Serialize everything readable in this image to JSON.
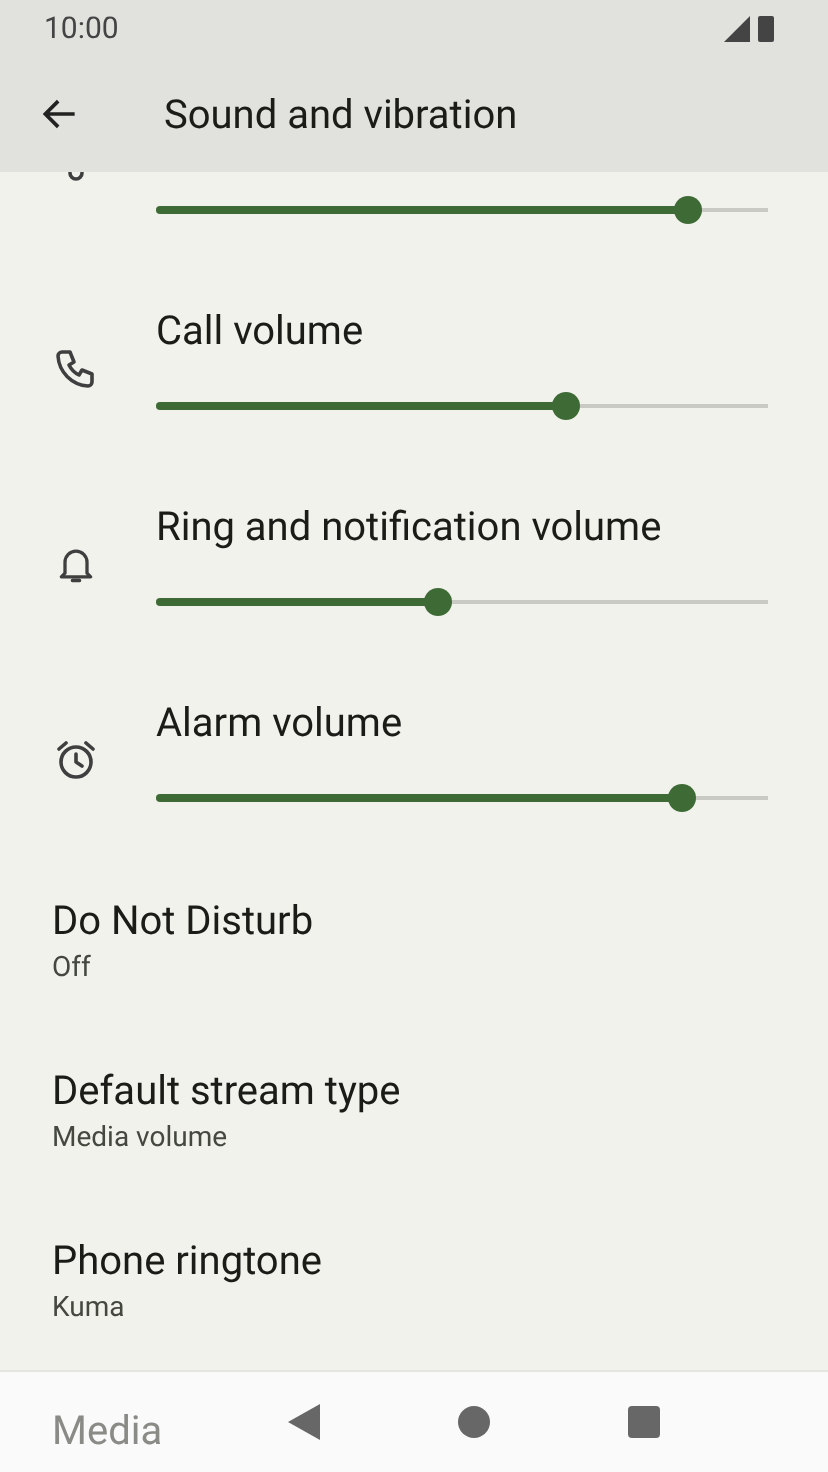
{
  "status_bar": {
    "time": "10:00"
  },
  "app_bar": {
    "title": "Sound and vibration"
  },
  "items": [
    {
      "kind": "slider",
      "level": 0.87
    },
    {
      "kind": "slider",
      "title": "Call volume",
      "level": 0.67
    },
    {
      "kind": "slider",
      "title": "Ring and notification volume",
      "level": 0.46
    },
    {
      "kind": "slider",
      "title": "Alarm volume",
      "level": 0.86
    },
    {
      "kind": "setting",
      "title": "Do Not Disturb",
      "subtitle": "Off"
    },
    {
      "kind": "setting",
      "title": "Default stream type",
      "subtitle": "Media volume"
    },
    {
      "kind": "setting",
      "title": "Phone ringtone",
      "subtitle": "Kuma"
    },
    {
      "kind": "setting",
      "title": "Media"
    }
  ]
}
